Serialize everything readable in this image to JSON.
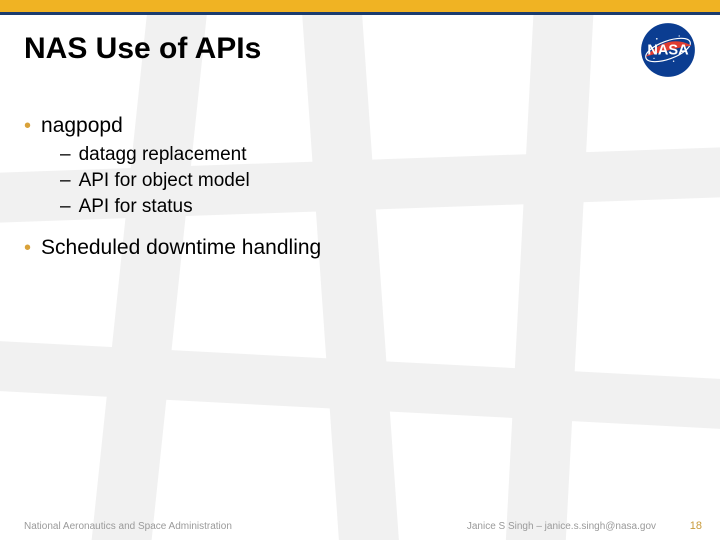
{
  "title": "NAS Use of APIs",
  "logo_name": "nasa-logo",
  "bullets": [
    {
      "text": "nagpopd",
      "sub": [
        "datagg replacement",
        "API for object model",
        "API for status"
      ]
    },
    {
      "text": "Scheduled downtime handling",
      "sub": []
    }
  ],
  "footer": {
    "org": "National Aeronautics and Space Administration",
    "author": "Janice S Singh – janice.s.singh@nasa.gov",
    "page": "18"
  },
  "colors": {
    "accent_bar": "#f0b323",
    "underline": "#1b3c6e",
    "bullet_dot": "#d9a23a"
  }
}
